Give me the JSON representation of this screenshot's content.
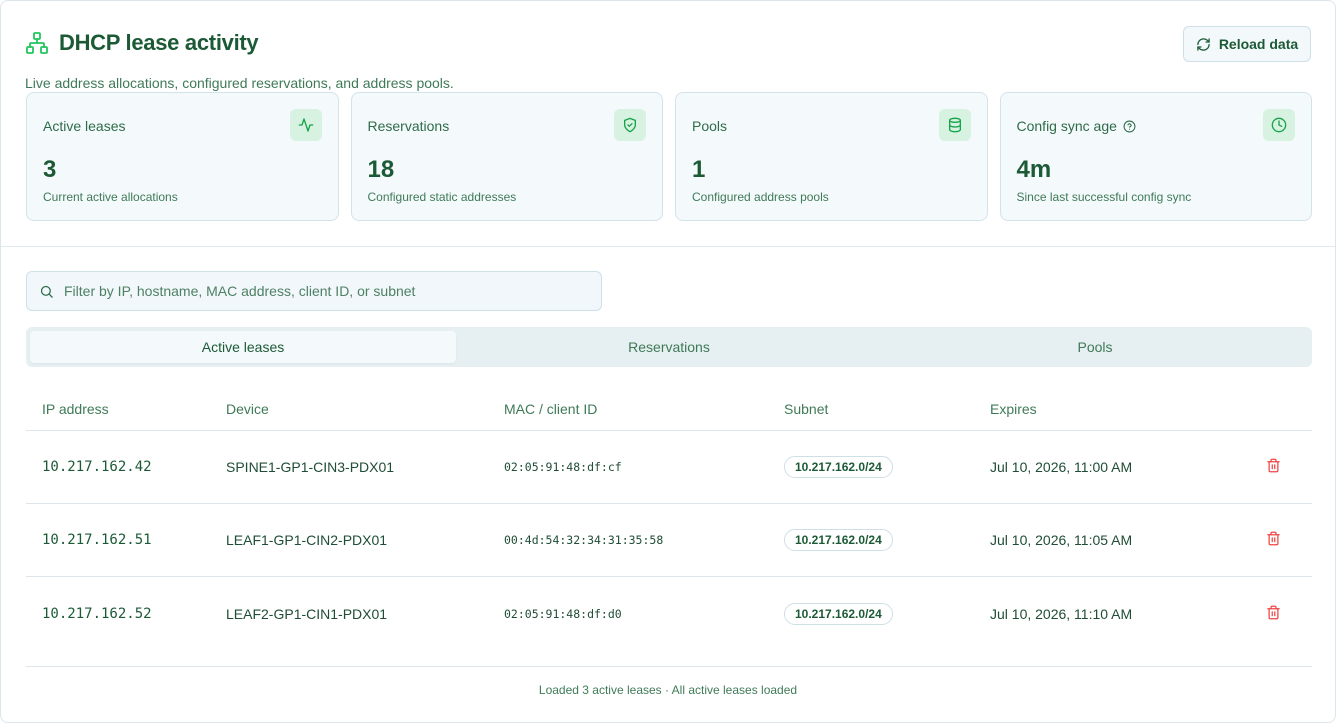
{
  "header": {
    "title": "DHCP lease activity",
    "subtitle": "Live address allocations, configured reservations, and address pools.",
    "title_icon": "network-icon",
    "reload_label": "Reload data",
    "reload_icon": "refresh-icon"
  },
  "stats": [
    {
      "label": "Active leases",
      "value": "3",
      "caption": "Current active allocations",
      "icon": "activity-icon"
    },
    {
      "label": "Reservations",
      "value": "18",
      "caption": "Configured static addresses",
      "icon": "shield-check-icon"
    },
    {
      "label": "Pools",
      "value": "1",
      "caption": "Configured address pools",
      "icon": "database-icon"
    },
    {
      "label": "Config sync age",
      "value": "4m",
      "caption": "Since last successful config sync",
      "icon": "clock-icon",
      "help_icon": "help-circle-icon"
    }
  ],
  "search": {
    "placeholder": "Filter by IP, hostname, MAC address, client ID, or subnet",
    "value": ""
  },
  "tabs": [
    {
      "label": "Active leases",
      "active": true
    },
    {
      "label": "Reservations",
      "active": false
    },
    {
      "label": "Pools",
      "active": false
    }
  ],
  "table": {
    "columns": [
      "IP address",
      "Device",
      "MAC / client ID",
      "Subnet",
      "Expires"
    ],
    "rows": [
      {
        "ip": "10.217.162.42",
        "device": "SPINE1-GP1-CIN3-PDX01",
        "mac": "02:05:91:48:df:cf",
        "subnet": "10.217.162.0/24",
        "expires": "Jul 10, 2026, 11:00 AM"
      },
      {
        "ip": "10.217.162.51",
        "device": "LEAF1-GP1-CIN2-PDX01",
        "mac": "00:4d:54:32:34:31:35:58",
        "subnet": "10.217.162.0/24",
        "expires": "Jul 10, 2026, 11:05 AM"
      },
      {
        "ip": "10.217.162.52",
        "device": "LEAF2-GP1-CIN1-PDX01",
        "mac": "02:05:91:48:df:d0",
        "subnet": "10.217.162.0/24",
        "expires": "Jul 10, 2026, 11:10 AM"
      }
    ],
    "row_action_icon": "trash-icon"
  },
  "footer": {
    "status": "Loaded 3 active leases · All active leases loaded"
  },
  "colors": {
    "accent": "#22c55e",
    "accent_dark": "#1c5a36",
    "danger": "#ef4444",
    "card_bg": "#f4f9fc"
  }
}
